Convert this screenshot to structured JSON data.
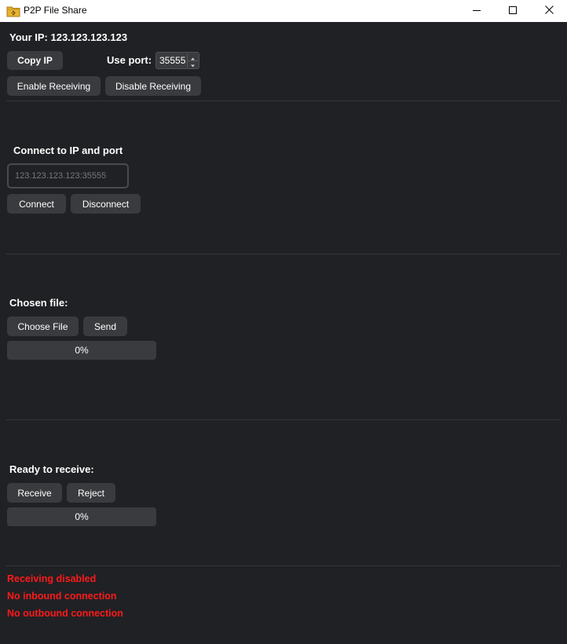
{
  "window": {
    "title": "P2P File Share",
    "icon": "folder-app-icon",
    "controls": [
      "minimize",
      "maximize",
      "close"
    ]
  },
  "receiving": {
    "your_ip_label": "Your IP: 123.123.123.123",
    "copy_ip_label": "Copy IP",
    "use_port_label": "Use port:",
    "port_value": "35555",
    "enable_label": "Enable Receiving",
    "disable_label": "Disable Receiving"
  },
  "connect": {
    "heading": "Connect to IP and port",
    "input_placeholder": "123.123.123.123:35555",
    "connect_label": "Connect",
    "disconnect_label": "Disconnect"
  },
  "send": {
    "heading": "Chosen file:",
    "choose_label": "Choose File",
    "send_label": "Send",
    "progress_text": "0%",
    "progress": 0
  },
  "receive": {
    "heading": "Ready to receive:",
    "receive_label": "Receive",
    "reject_label": "Reject",
    "progress_text": "0%",
    "progress": 0
  },
  "status": {
    "receiving": "Receiving disabled",
    "inbound": "No inbound connection",
    "outbound": "No outbound connection",
    "color": "#ff1a1a"
  },
  "colors": {
    "background": "#202124",
    "button": "#3a3b3e",
    "text": "#ffffff"
  }
}
